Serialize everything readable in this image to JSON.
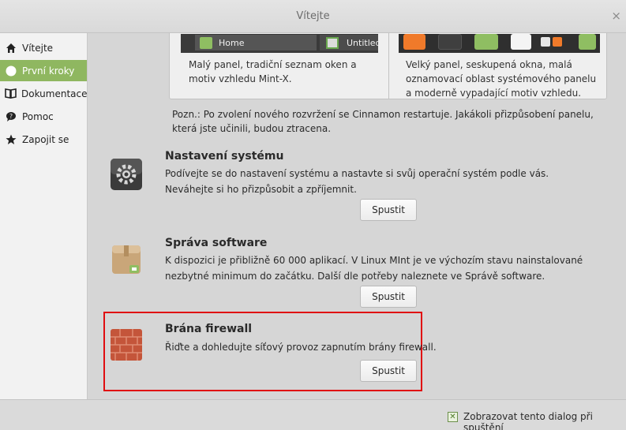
{
  "window": {
    "title": "Vítejte",
    "close_glyph": "×"
  },
  "sidebar": {
    "items": [
      {
        "label": "Vítejte",
        "icon": "home-icon"
      },
      {
        "label": "První kroky",
        "icon": "info-icon",
        "active": true
      },
      {
        "label": "Dokumentace",
        "icon": "book-icon"
      },
      {
        "label": "Pomoc",
        "icon": "chat-bubble-icon"
      },
      {
        "label": "Zapojit se",
        "icon": "star-icon"
      }
    ]
  },
  "layouts": {
    "left": {
      "home_label": "Home",
      "untitled_label": "Untitled",
      "description": "Malý panel, tradiční seznam oken a motiv vzhledu Mint-X."
    },
    "right": {
      "description": "Velký panel, seskupená okna, malá oznamovací oblast systémového panelu a moderně vypadající motiv vzhledu."
    },
    "note": "Pozn.: Po zvolení nového rozvržení se Cinnamon restartuje. Jakákoli přizpůsobení panelu, která jste učinili, budou ztracena."
  },
  "sections": [
    {
      "title": "Nastavení systému",
      "description": "Podívejte se do nastavení systému a nastavte si svůj operační systém podle vás. Neváhejte si ho přizpůsobit a zpříjemnit.",
      "button": "Spustit",
      "icon": "system-settings-icon"
    },
    {
      "title": "Správa software",
      "description": "K dispozici je přibližně 60 000 aplikací. V Linux MInt je ve výchozím stavu nainstalované nezbytné minimum do začátku. Další dle potřeby naleznete ve Správě software.",
      "button": "Spustit",
      "icon": "software-manager-icon"
    },
    {
      "title": "Brána firewall",
      "description": "Řiďte a dohledujte síťový provoz zapnutím brány firewall.",
      "button": "Spustit",
      "icon": "firewall-brick-wall-icon"
    }
  ],
  "footer": {
    "checkbox_label": "Zobrazovat tento dialog při spuštění",
    "checked": true,
    "check_glyph": "✕"
  },
  "colors": {
    "accent": "#8fb760",
    "highlight": "#e00d10"
  }
}
